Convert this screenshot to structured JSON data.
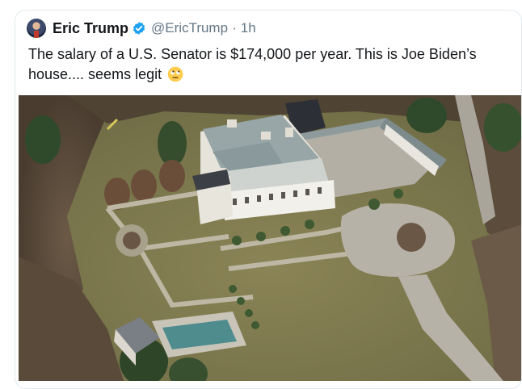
{
  "tweet": {
    "author_name": "Eric Trump",
    "handle": "@EricTrump",
    "separator": "·",
    "time": "1h",
    "text": "The salary of a U.S. Senator is $174,000 per year. This is Joe Biden’s house.... seems legit",
    "emoji": "face-with-rolling-eyes-icon",
    "verified": true
  },
  "colors": {
    "text": "#14171a",
    "secondary": "#657786",
    "verified_blue": "#1da1f2",
    "border": "#e1e8ed"
  }
}
